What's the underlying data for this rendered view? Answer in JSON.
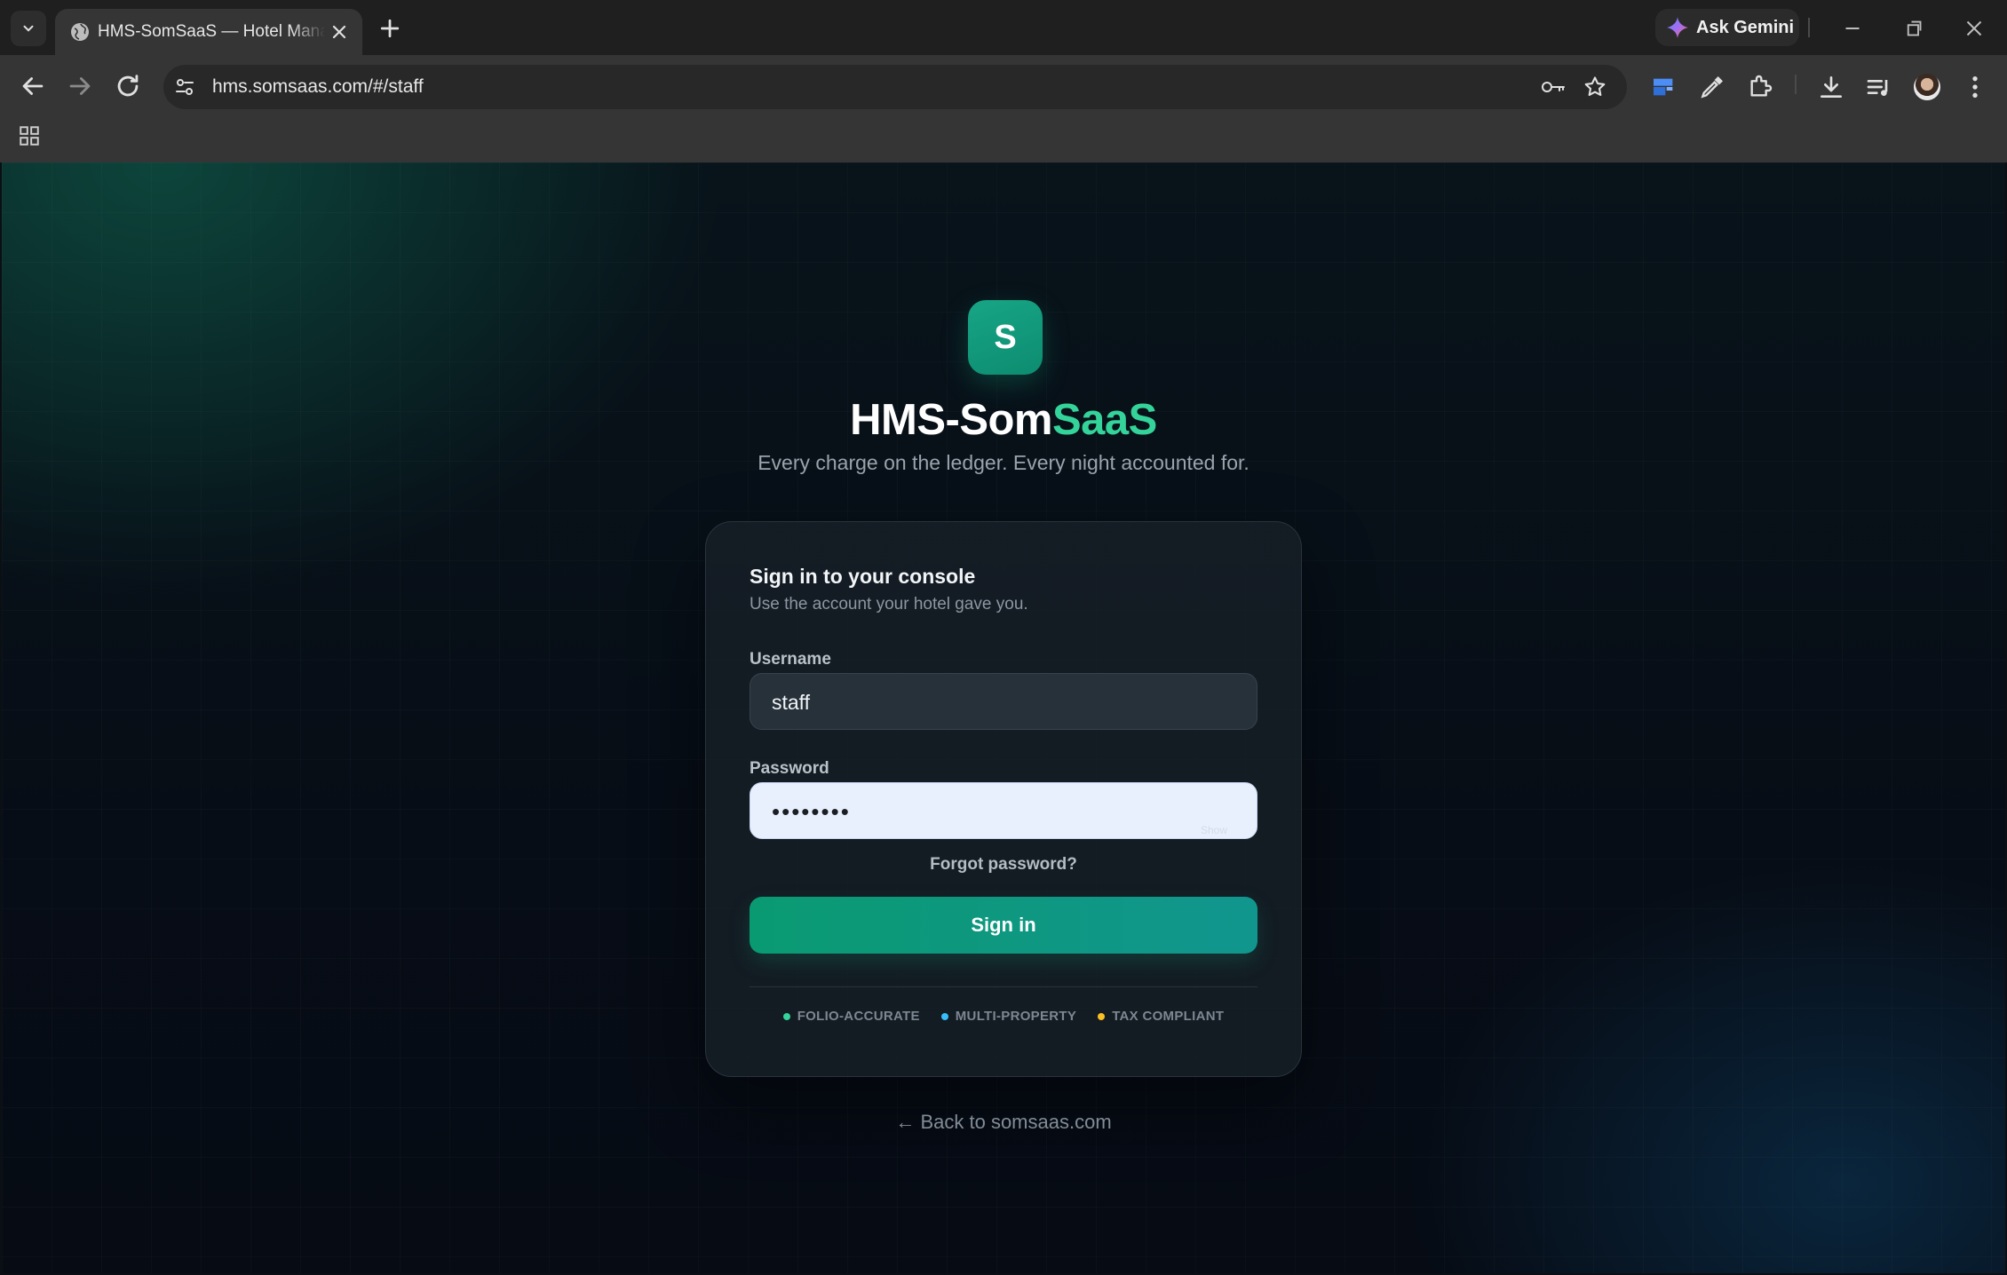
{
  "browser": {
    "tab_title": "HMS-SomSaaS — Hotel Management",
    "url": "hms.somsaas.com/#/staff",
    "gemini_label": "Ask Gemini"
  },
  "brand": {
    "logo_letter": "S",
    "name_primary": "HMS-Som",
    "name_accent": "SaaS",
    "tagline": "Every charge on the ledger. Every night accounted for.",
    "accent_color": "#34d399"
  },
  "login": {
    "heading": "Sign in to your console",
    "subheading": "Use the account your hotel gave you.",
    "username_label": "Username",
    "username_value": "staff",
    "password_label": "Password",
    "password_value": "••••••••",
    "show_label": "Show",
    "forgot_label": "Forgot password?",
    "submit_label": "Sign in",
    "badges": [
      {
        "label": "FOLIO-ACCURATE",
        "color": "#34d399"
      },
      {
        "label": "MULTI-PROPERTY",
        "color": "#38bdf8"
      },
      {
        "label": "TAX COMPLIANT",
        "color": "#fbbf24"
      }
    ]
  },
  "footer": {
    "back_link": "← Back to somsaas.com"
  }
}
